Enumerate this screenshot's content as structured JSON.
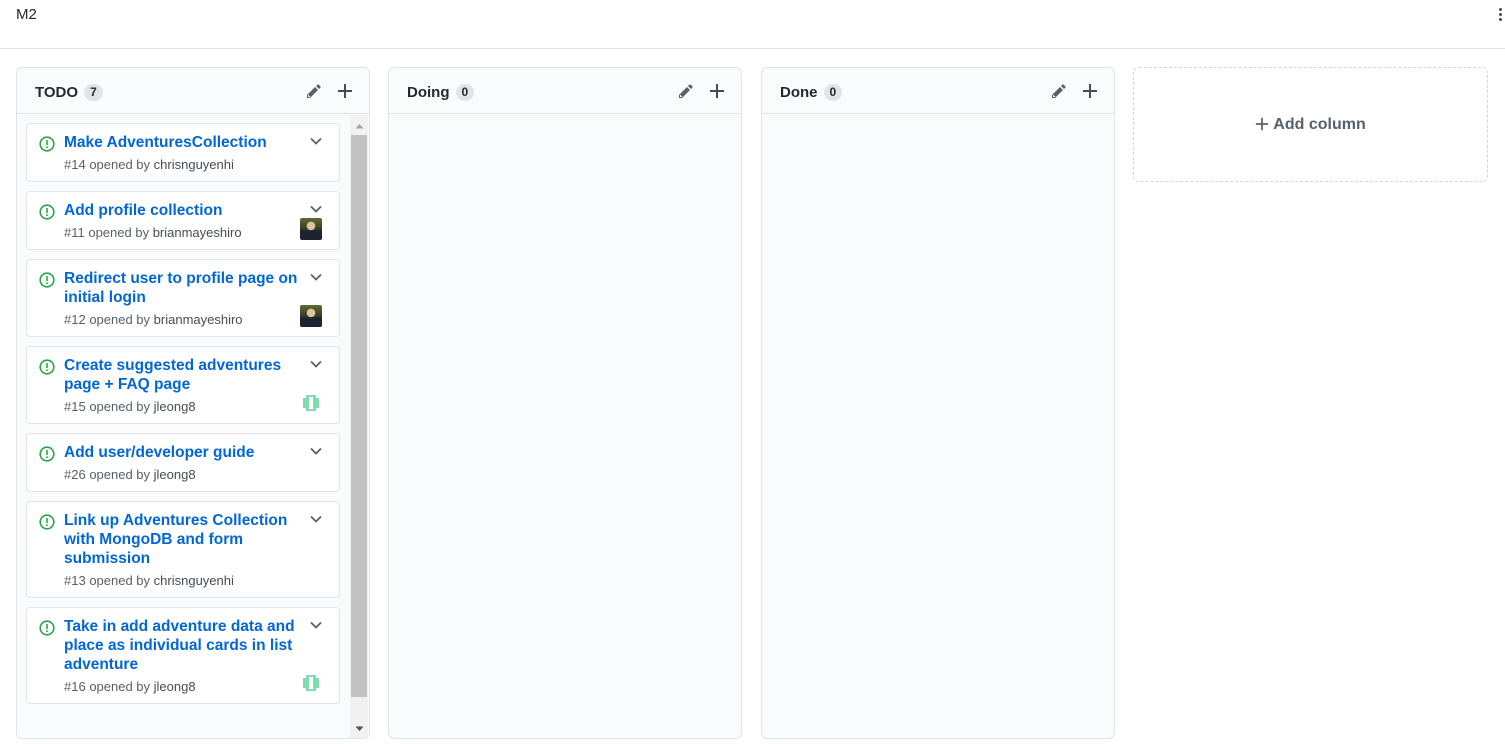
{
  "project": {
    "title": "M2"
  },
  "columns": [
    {
      "name": "TODO",
      "count": "7",
      "cards": [
        {
          "title": "Make AdventuresCollection",
          "number": "#14",
          "opened_by": " opened by ",
          "author": "chrisnguyenhi",
          "avatar": "none"
        },
        {
          "title": "Add profile collection",
          "number": "#11",
          "opened_by": " opened by ",
          "author": "brianmayeshiro",
          "avatar": "photo"
        },
        {
          "title": "Redirect user to profile page on initial login",
          "number": "#12",
          "opened_by": " opened by ",
          "author": "brianmayeshiro",
          "avatar": "photo"
        },
        {
          "title": "Create suggested adventures page + FAQ page",
          "number": "#15",
          "opened_by": " opened by ",
          "author": "jleong8",
          "avatar": "identicon"
        },
        {
          "title": "Add user/developer guide",
          "number": "#26",
          "opened_by": " opened by ",
          "author": "jleong8",
          "avatar": "none"
        },
        {
          "title": "Link up Adventures Collection with MongoDB and form submission",
          "number": "#13",
          "opened_by": " opened by ",
          "author": "chrisnguyenhi",
          "avatar": "none"
        },
        {
          "title": "Take in add adventure data and place as individual cards in list adventure",
          "number": "#16",
          "opened_by": " opened by ",
          "author": "jleong8",
          "avatar": "identicon"
        }
      ]
    },
    {
      "name": "Doing",
      "count": "0",
      "cards": []
    },
    {
      "name": "Done",
      "count": "0",
      "cards": []
    }
  ],
  "add_column": {
    "label": "Add column"
  },
  "icons": {
    "issue": "issue-opened-icon",
    "edit": "pencil-icon",
    "add": "plus-icon",
    "menu": "chevron-down-icon",
    "more": "kebab-icon"
  },
  "colors": {
    "link": "#0366d6",
    "open_issue": "#28a745",
    "identicon": "#7fdcae"
  }
}
